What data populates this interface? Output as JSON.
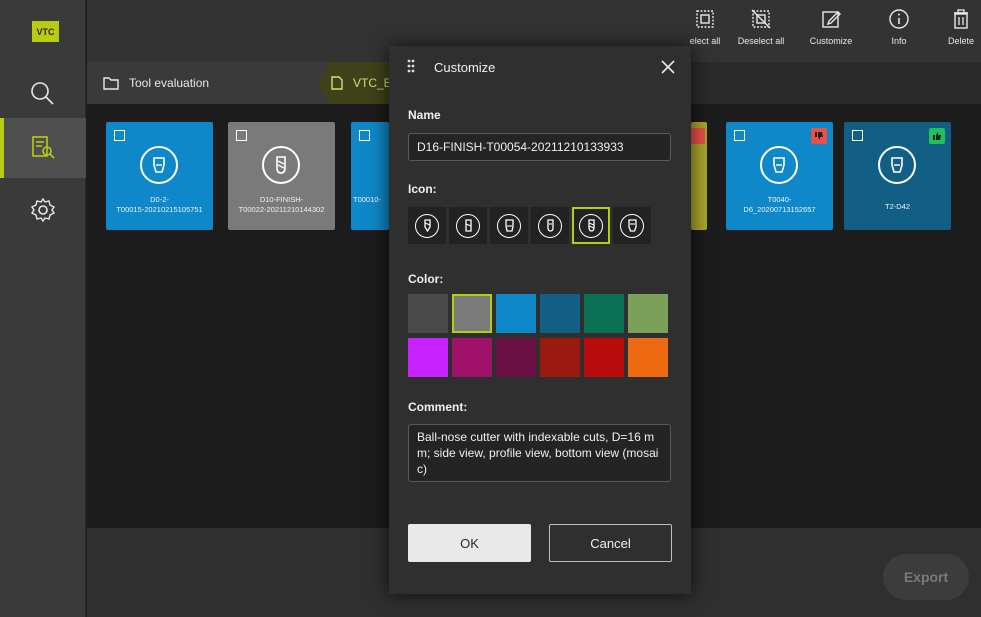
{
  "app": {
    "logo": "VTC"
  },
  "rail": {
    "items": [
      {
        "name": "search",
        "icon": "magnifier-icon",
        "active": false
      },
      {
        "name": "tool-evaluation",
        "icon": "evaluation-icon",
        "active": true
      },
      {
        "name": "settings",
        "icon": "gear-icon",
        "active": false
      }
    ]
  },
  "toolbar": {
    "select_all": "elect all",
    "deselect_all": "Deselect all",
    "customize": "Customize",
    "info": "Info",
    "delete": "Delete"
  },
  "breadcrumb": {
    "root": "Tool evaluation",
    "current": "VTC_E"
  },
  "cards": [
    {
      "name": "D0-2-\nT00015-20210215105751",
      "color": "#0e88c9",
      "badge": ""
    },
    {
      "name": "D10-FINISH-\nT00022-20211210144302",
      "color": "#7a7a7a",
      "badge": ""
    },
    {
      "name": "T00010-",
      "color": "#0e88c9",
      "badge": ""
    },
    {
      "name": "T0040-\nD6_20200713152657",
      "color": "#0e88c9",
      "badge": "thumbs-down"
    },
    {
      "name": "T2-D42",
      "color": "#125f86",
      "badge": "thumbs-up"
    }
  ],
  "bottom": {
    "export": "Export"
  },
  "dialog": {
    "title": "Customize",
    "name_label": "Name",
    "name_value": "D16-FINISH-T00054-20211210133933",
    "icon_label": "Icon:",
    "icons": [
      "drill-icon",
      "end-mill-icon",
      "insert-mill-icon",
      "thread-mill-icon",
      "ball-nose-icon",
      "shell-mill-icon"
    ],
    "icon_selected_index": 4,
    "color_label": "Color:",
    "colors": [
      "#4a4a4a",
      "#7a7a7a",
      "#0e88c9",
      "#125f86",
      "#0a7154",
      "#7aa05a",
      "#c621ff",
      "#a0126a",
      "#6b1045",
      "#9a1a10",
      "#b90c0c",
      "#ee6a10"
    ],
    "color_selected_index": 1,
    "comment_label": "Comment:",
    "comment_value": "Ball-nose cutter with indexable cuts, D=16 mm; side view, profile view, bottom view (mosaic)",
    "ok": "OK",
    "cancel": "Cancel"
  }
}
